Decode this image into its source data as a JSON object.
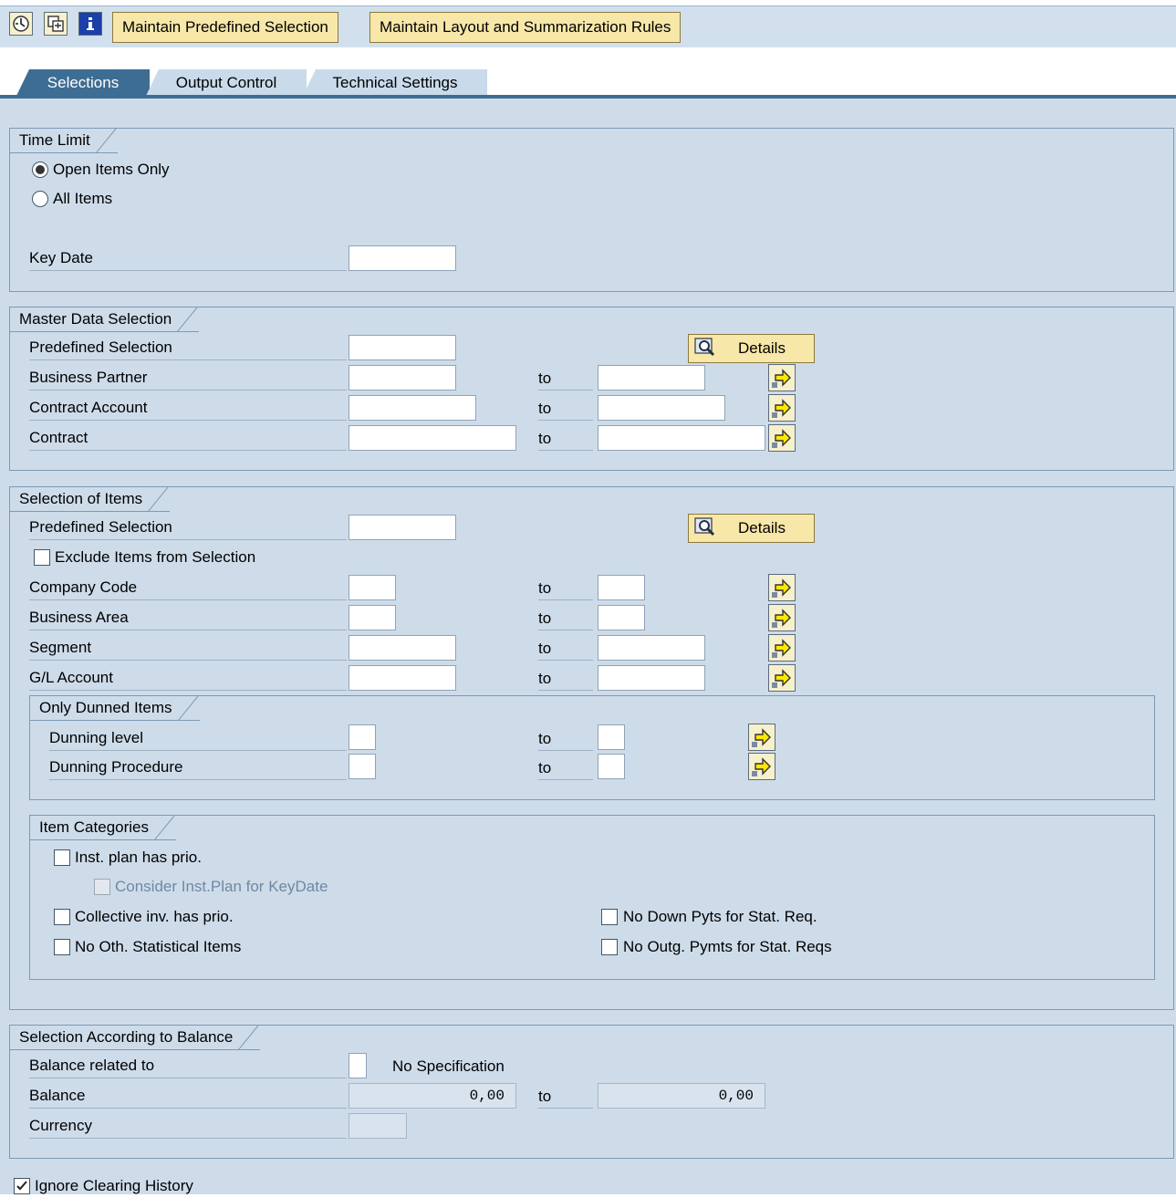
{
  "toolbar": {
    "icons": [
      "execute-icon",
      "copy-variant-icon",
      "info-icon"
    ],
    "maintain_predefined_selection": "Maintain Predefined Selection",
    "maintain_layout": "Maintain Layout and Summarization Rules"
  },
  "tabs": [
    {
      "label": "Selections",
      "active": true
    },
    {
      "label": "Output Control",
      "active": false
    },
    {
      "label": "Technical Settings",
      "active": false
    }
  ],
  "time_limit": {
    "title": "Time Limit",
    "open_items_only": "Open Items Only",
    "all_items": "All Items",
    "selected": "open_items_only",
    "key_date_label": "Key Date",
    "key_date_value": ""
  },
  "master_data": {
    "title": "Master Data Selection",
    "predefined_selection": "Predefined Selection",
    "details": "Details",
    "business_partner": "Business Partner",
    "contract_account": "Contract Account",
    "contract": "Contract",
    "to": "to"
  },
  "items": {
    "title": "Selection of Items",
    "predefined_selection": "Predefined Selection",
    "details": "Details",
    "exclude_items": "Exclude Items from Selection",
    "company_code": "Company Code",
    "business_area": "Business Area",
    "segment": "Segment",
    "gl_account": "G/L Account",
    "to": "to",
    "dunned": {
      "title": "Only Dunned Items",
      "dunning_level": "Dunning level",
      "dunning_procedure": "Dunning Procedure"
    },
    "categories": {
      "title": "Item Categories",
      "inst_plan_prio": "Inst. plan has prio.",
      "consider_inst_plan": "Consider Inst.Plan for KeyDate",
      "collective_inv_prio": "Collective inv. has prio.",
      "no_oth_statistical": "No Oth. Statistical Items",
      "no_down_pyts": "No Down Pyts for Stat. Req.",
      "no_outg_pymts": "No Outg. Pymts for Stat. Reqs"
    }
  },
  "balance": {
    "title": "Selection According to Balance",
    "balance_related_to": "Balance related to",
    "no_specification": "No Specification",
    "balance_label": "Balance",
    "balance_from": "0,00",
    "balance_to": "0,00",
    "to": "to",
    "currency": "Currency"
  },
  "ignore_clearing_history": {
    "label": "Ignore Clearing History",
    "checked": true
  }
}
